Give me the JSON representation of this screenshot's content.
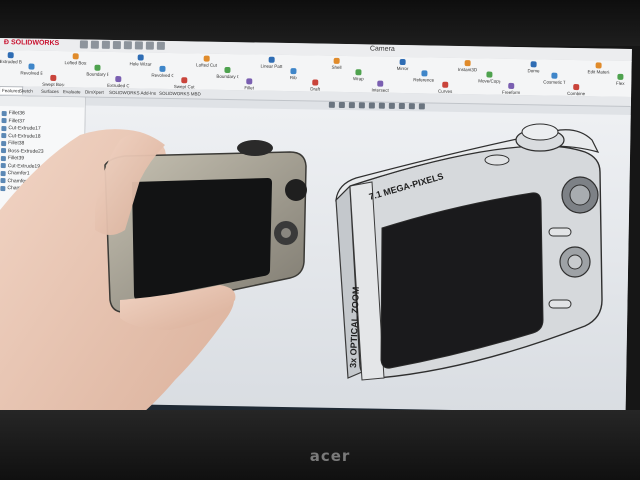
{
  "window": {
    "app_name": "SOLIDWORKS",
    "document_title": "Camera"
  },
  "ribbon": {
    "buttons": [
      "Extruded Boss/Base",
      "Revolved Boss/Base",
      "Swept Boss/Base",
      "Lofted Boss/Base",
      "Boundary Boss/Base",
      "Extruded Cut",
      "Hole Wizard",
      "Revolved Cut",
      "Swept Cut",
      "Lofted Cut",
      "Boundary Cut",
      "Fillet",
      "Linear Pattern",
      "Rib",
      "Draft",
      "Shell",
      "Wrap",
      "Intersect",
      "Mirror",
      "Reference Geometry",
      "Curves",
      "Instant3D",
      "Move/Copy Bodies",
      "Freeform",
      "Dome",
      "Cosmetic Thread",
      "Combine",
      "Edit Material",
      "Flex"
    ]
  },
  "command_tabs": [
    "Features",
    "Sketch",
    "Surfaces",
    "Evaluate",
    "DimXpert",
    "SOLIDWORKS Add-Ins",
    "SOLIDWORKS MBD"
  ],
  "feature_tree": [
    "Fillet36",
    "Fillet37",
    "Cut-Extrude17",
    "Cut-Extrude18",
    "Fillet38",
    "Boss-Extrude23",
    "Fillet39",
    "Cut-Extrude19",
    "Chamfer1",
    "Chamfer2",
    "Chamfer3"
  ],
  "model": {
    "side_text_1": "3x OPTICAL ZOOM",
    "side_text_2": "7.1 MEGA-PIXELS"
  },
  "monitor": {
    "brand": "acer"
  },
  "colors": {
    "viewport_bg": "#dfe2e6",
    "model_body": "#d2d5d8",
    "model_screen": "#1a1a1c",
    "bezel": "#161616",
    "logo_red": "#c8102e"
  }
}
